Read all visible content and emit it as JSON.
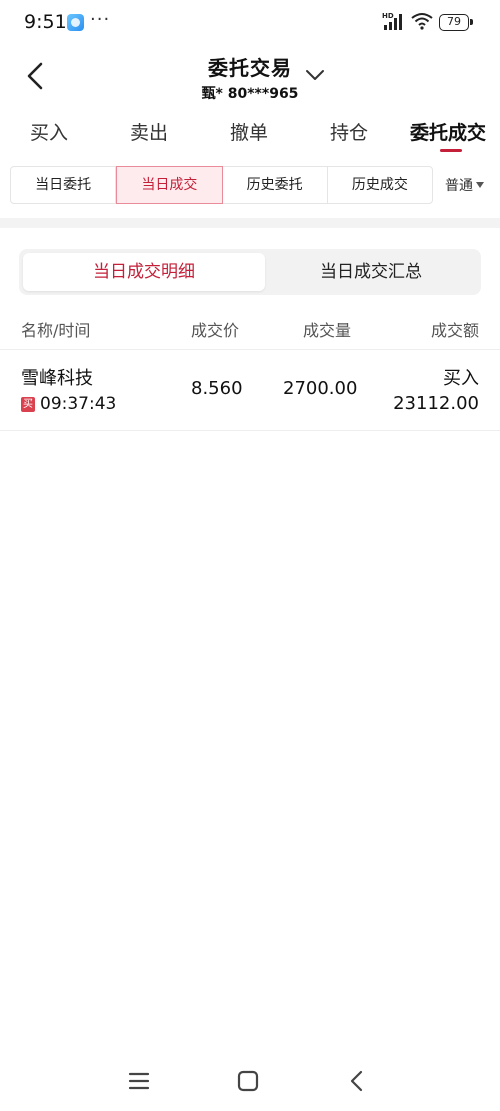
{
  "status_bar": {
    "time": "9:51",
    "dots": "···",
    "hd_label": "HD",
    "battery": "79"
  },
  "header": {
    "title": "委托交易",
    "account": "甄* 80***965"
  },
  "main_tabs": [
    {
      "label": "买入"
    },
    {
      "label": "卖出"
    },
    {
      "label": "撤单"
    },
    {
      "label": "持仓"
    },
    {
      "label": "委托成交",
      "active": true
    }
  ],
  "sub_tabs": [
    {
      "label": "当日委托"
    },
    {
      "label": "当日成交",
      "active": true
    },
    {
      "label": "历史委托"
    },
    {
      "label": "历史成交"
    }
  ],
  "filter": {
    "label": "普通"
  },
  "segment": {
    "active_label": "当日成交明细",
    "inactive_label": "当日成交汇总"
  },
  "table": {
    "headers": {
      "name": "名称/时间",
      "price": "成交价",
      "qty": "成交量",
      "amount": "成交额"
    },
    "rows": [
      {
        "name": "雪峰科技",
        "badge": "买",
        "time": "09:37:43",
        "price": "8.560",
        "qty": "2700.00",
        "direction": "买入",
        "amount": "23112.00"
      }
    ]
  },
  "colors": {
    "accent": "#c4203a",
    "active_tab_bg": "#fdebed",
    "buy_badge": "#d9414f"
  }
}
